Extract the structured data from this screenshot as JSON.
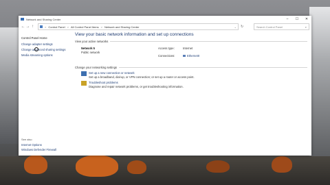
{
  "window": {
    "title": "Network and Sharing Center",
    "controls": [
      "–",
      "☐",
      "✕"
    ]
  },
  "addressbar": {
    "back": "←",
    "forward": "→",
    "up": "↑",
    "crumbs": [
      "Control Panel",
      "All Control Panel Items",
      "Network and Sharing Center"
    ],
    "separator": ">",
    "refresh": "↻",
    "search_placeholder": "Search Control Panel",
    "search_icon": "⌕"
  },
  "sidebar": {
    "home": "Control Panel Home",
    "items": [
      "Change adapter settings",
      "Change advanced sharing settings",
      "Media streaming options"
    ],
    "see_also": "See also",
    "bottom": [
      "Internet Options",
      "Windows Defender Firewall"
    ]
  },
  "main": {
    "title": "View your basic network information and set up connections",
    "active_heading": "View your active networks",
    "network": {
      "name": "Network 5",
      "category": "Public network",
      "access_label": "Access type:",
      "access_value": "Internet",
      "connections_label": "Connections:",
      "connections_value": "Ethernet0"
    },
    "change_heading": "Change your networking settings",
    "tasks": [
      {
        "link": "Set up a new connection or network",
        "desc": "Set up a broadband, dial-up, or VPN connection; or set up a router or access point."
      },
      {
        "link": "Troubleshoot problems",
        "desc": "Diagnose and repair network problems, or get troubleshooting information."
      }
    ]
  }
}
